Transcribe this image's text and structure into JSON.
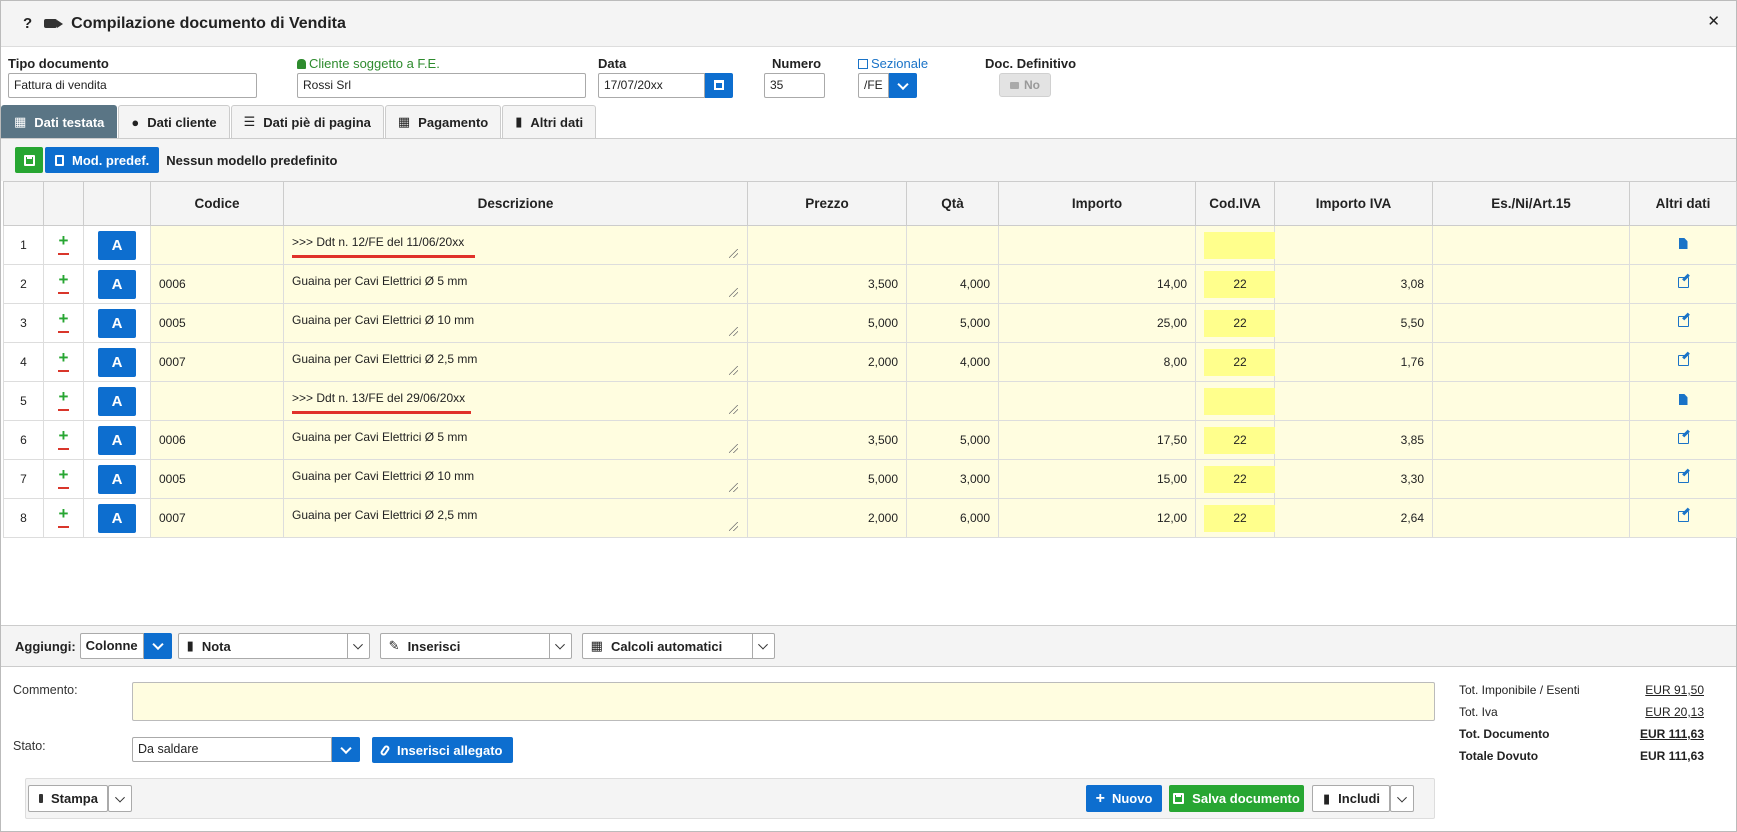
{
  "window": {
    "title": "Compilazione documento di Vendita",
    "help": "?",
    "close": "✕"
  },
  "header": {
    "tipo_label": "Tipo documento",
    "tipo_value": "Fattura di vendita",
    "cliente_label": "Cliente soggetto a F.E.",
    "cliente_value": "Rossi Srl",
    "data_label": "Data",
    "data_value": "17/07/20xx",
    "numero_label": "Numero",
    "numero_value": "35",
    "sezionale_label": "Sezionale",
    "sezionale_value": "/FE",
    "definitivo_label": "Doc. Definitivo",
    "definitivo_value": "No"
  },
  "tabs": [
    {
      "label": "Dati testata",
      "icon": "table-icon",
      "active": true
    },
    {
      "label": "Dati cliente",
      "icon": "user-icon"
    },
    {
      "label": "Dati piè di pagina",
      "icon": "list-icon"
    },
    {
      "label": "Pagamento",
      "icon": "calendar-icon"
    },
    {
      "label": "Altri dati",
      "icon": "file-icon"
    }
  ],
  "toolbar": {
    "mod_label": "Mod. predef.",
    "no_model": "Nessun modello predefinito"
  },
  "columns": [
    "Codice",
    "Descrizione",
    "Prezzo",
    "Qtà",
    "Importo",
    "Cod.IVA",
    "Importo IVA",
    "Es./Ni/Art.15",
    "Altri dati"
  ],
  "rows": [
    {
      "n": "1",
      "codice": "",
      "descrizione": ">>> Ddt n. 12/FE del 11/06/20xx",
      "prezzo": "",
      "qta": "",
      "importo": "",
      "iva": "",
      "importo_iva": "",
      "es": "",
      "ddt": true
    },
    {
      "n": "2",
      "codice": "0006",
      "descrizione": "Guaina per Cavi Elettrici Ø 5 mm",
      "prezzo": "3,500",
      "qta": "4,000",
      "importo": "14,00",
      "iva": "22",
      "importo_iva": "3,08",
      "es": ""
    },
    {
      "n": "3",
      "codice": "0005",
      "descrizione": "Guaina per Cavi Elettrici Ø 10 mm",
      "prezzo": "5,000",
      "qta": "5,000",
      "importo": "25,00",
      "iva": "22",
      "importo_iva": "5,50",
      "es": ""
    },
    {
      "n": "4",
      "codice": "0007",
      "descrizione": "Guaina per Cavi Elettrici Ø 2,5 mm",
      "prezzo": "2,000",
      "qta": "4,000",
      "importo": "8,00",
      "iva": "22",
      "importo_iva": "1,76",
      "es": ""
    },
    {
      "n": "5",
      "codice": "",
      "descrizione": ">>> Ddt n. 13/FE del 29/06/20xx",
      "prezzo": "",
      "qta": "",
      "importo": "",
      "iva": "",
      "importo_iva": "",
      "es": "",
      "ddt": true
    },
    {
      "n": "6",
      "codice": "0006",
      "descrizione": "Guaina per Cavi Elettrici Ø 5 mm",
      "prezzo": "3,500",
      "qta": "5,000",
      "importo": "17,50",
      "iva": "22",
      "importo_iva": "3,85",
      "es": ""
    },
    {
      "n": "7",
      "codice": "0005",
      "descrizione": "Guaina per Cavi Elettrici Ø 10 mm",
      "prezzo": "5,000",
      "qta": "3,000",
      "importo": "15,00",
      "iva": "22",
      "importo_iva": "3,30",
      "es": ""
    },
    {
      "n": "8",
      "codice": "0007",
      "descrizione": "Guaina per Cavi Elettrici Ø 2,5 mm",
      "prezzo": "2,000",
      "qta": "6,000",
      "importo": "12,00",
      "iva": "22",
      "importo_iva": "2,64",
      "es": ""
    }
  ],
  "row_button_label": "A",
  "addbar": {
    "label": "Aggiungi:",
    "colonne": "Colonne",
    "nota": "Nota",
    "inserisci": "Inserisci",
    "calcoli": "Calcoli automatici"
  },
  "footer": {
    "commento_label": "Commento:",
    "commento_value": "",
    "stato_label": "Stato:",
    "stato_value": "Da saldare",
    "allegato": "Inserisci allegato",
    "stampa": "Stampa",
    "nuovo": "Nuovo",
    "salva": "Salva documento",
    "includi": "Includi"
  },
  "totals": [
    {
      "label": "Tot. Imponibile / Esenti",
      "value": "EUR 91,50"
    },
    {
      "label": "Tot. Iva",
      "value": "EUR 20,13"
    },
    {
      "label": "Tot. Documento",
      "value": "EUR 111,63"
    },
    {
      "label": "Totale Dovuto",
      "value": "EUR 111,63"
    }
  ],
  "colors": {
    "accent": "#0d6ecf",
    "green": "#27a632",
    "tab_active": "#5a7585",
    "row_bg": "#fffde0",
    "iva_bg": "#ffff8c",
    "ddt_underline": "#e0312a"
  }
}
